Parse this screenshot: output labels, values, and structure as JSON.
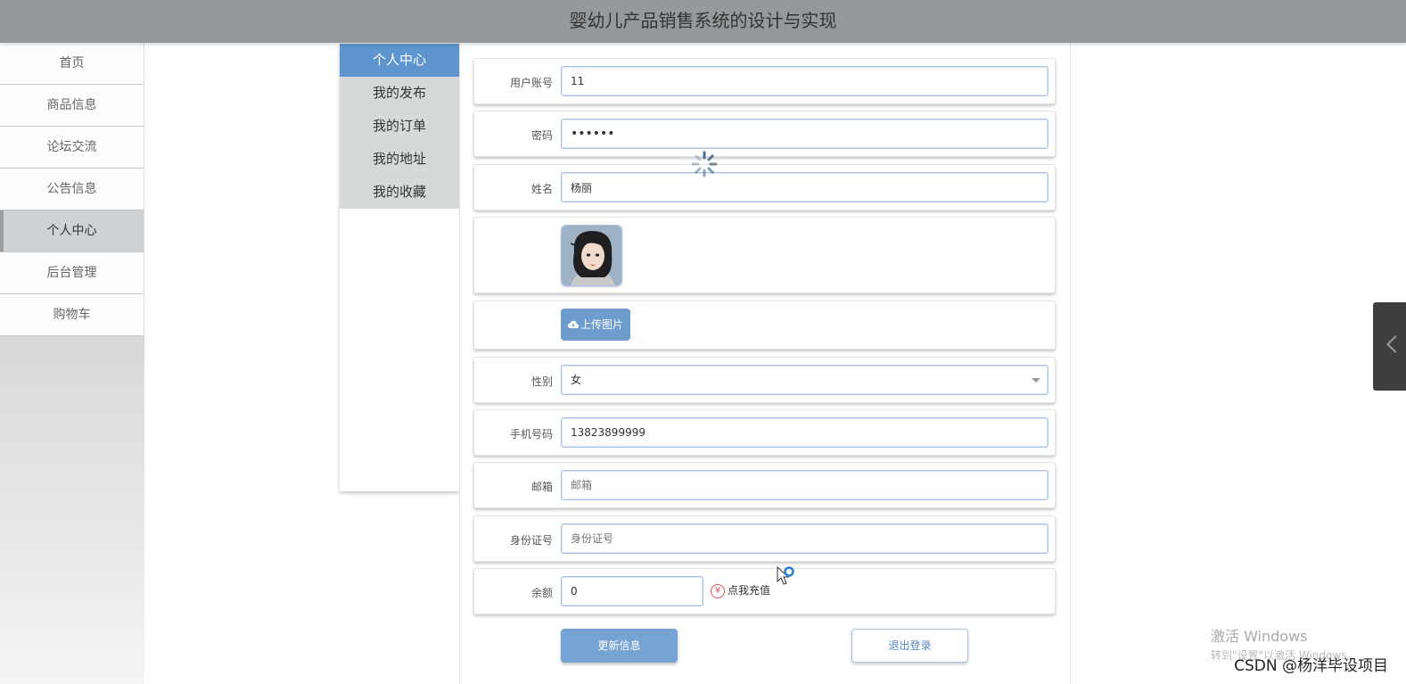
{
  "app": {
    "title": "婴幼儿产品销售系统的设计与实现"
  },
  "nav": {
    "items": [
      {
        "label": "首页",
        "active": false
      },
      {
        "label": "商品信息",
        "active": false
      },
      {
        "label": "论坛交流",
        "active": false
      },
      {
        "label": "公告信息",
        "active": false
      },
      {
        "label": "个人中心",
        "active": true
      },
      {
        "label": "后台管理",
        "active": false
      },
      {
        "label": "购物车",
        "active": false
      }
    ]
  },
  "subnav": {
    "items": [
      {
        "label": "个人中心",
        "active": true
      },
      {
        "label": "我的发布",
        "active": false
      },
      {
        "label": "我的订单",
        "active": false
      },
      {
        "label": "我的地址",
        "active": false
      },
      {
        "label": "我的收藏",
        "active": false
      }
    ]
  },
  "form": {
    "account": {
      "label": "用户账号",
      "value": "11"
    },
    "password": {
      "label": "密码",
      "value": "••••••"
    },
    "name": {
      "label": "姓名",
      "value": "杨丽"
    },
    "avatar": {
      "icon": "user-avatar-image"
    },
    "upload": {
      "label": "上传图片",
      "icon": "cloud-upload-icon"
    },
    "gender": {
      "label": "性别",
      "value": "女"
    },
    "phone": {
      "label": "手机号码",
      "value": "13823899999"
    },
    "email": {
      "label": "邮箱",
      "placeholder": "邮箱"
    },
    "idcard": {
      "label": "身份证号",
      "placeholder": "身份证号"
    },
    "balance": {
      "label": "余额",
      "value": "0",
      "recharge_label": "点我充值",
      "recharge_icon": "¥"
    }
  },
  "actions": {
    "update_label": "更新信息",
    "logout_label": "退出登录"
  },
  "overlay": {
    "windows_watermark": "激活 Windows",
    "windows_watermark_sub": "转到\"设置\"以激活 Windows。",
    "csdn_watermark": "CSDN @杨洋毕设项目"
  },
  "colors": {
    "accent": "#5e95ce",
    "topbar": "#96999b",
    "button": "#77a2d4"
  }
}
